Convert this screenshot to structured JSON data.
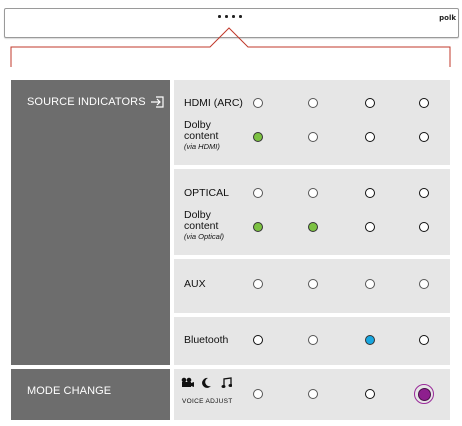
{
  "device": {
    "brand": "polk"
  },
  "left": {
    "source_indicators": "SOURCE INDICATORS",
    "mode_change": "MODE CHANGE",
    "input_icon": "input-arrow-icon"
  },
  "rows": {
    "hdmi": "HDMI (ARC)",
    "dolby_hdmi_main": "Dolby\ncontent",
    "dolby_hdmi_sub": "(via HDMI)",
    "optical": "OPTICAL",
    "dolby_optical_main": "Dolby\ncontent",
    "dolby_optical_sub": "(via Optical)",
    "aux": "AUX",
    "bluetooth": "Bluetooth",
    "voice_adjust": "VOICE ADJUST"
  },
  "mode_icons": [
    "movie-camera-icon",
    "night-moon-icon",
    "music-note-icon"
  ],
  "indicator_states": {
    "hdmi": [
      "off",
      "off",
      "off",
      "off"
    ],
    "dolby_hdmi": [
      "green",
      "off",
      "off",
      "off"
    ],
    "optical": [
      "off",
      "off",
      "off",
      "off"
    ],
    "dolby_optical": [
      "green",
      "green",
      "off",
      "off"
    ],
    "aux": [
      "off",
      "off",
      "off",
      "off"
    ],
    "bluetooth": [
      "off",
      "off",
      "blue",
      "off"
    ],
    "mode": [
      "off",
      "off",
      "off",
      "purple-ring"
    ]
  },
  "colors": {
    "panel_dark": "#6d6d6d",
    "panel_light": "#e6e6e6",
    "callout": "#c0392b",
    "green": "#7cc142",
    "blue": "#19a7e0",
    "purple": "#8e1f8e"
  }
}
